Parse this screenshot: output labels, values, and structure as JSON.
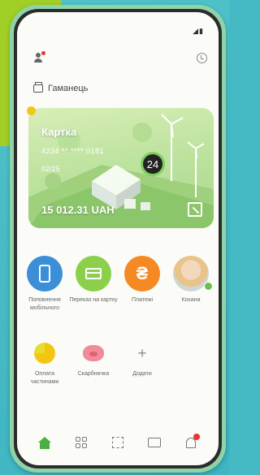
{
  "header": {
    "profile_icon": "profile-icon",
    "history_icon": "clock-icon"
  },
  "wallet": {
    "label": "Гаманець"
  },
  "card": {
    "title": "Картка",
    "number": "4234 ** **** 0181",
    "expiry": "02/25",
    "balance": "15 012.31 UAH",
    "day_badge": "24"
  },
  "actions": [
    {
      "label": "Поповнення мобільного",
      "icon": "phone-icon",
      "color": "#3b8fd6"
    },
    {
      "label": "Переказ на картку",
      "icon": "card-icon",
      "color": "#8ccf4a"
    },
    {
      "label": "Платежі",
      "icon": "hryvnia-icon",
      "color": "#f58a24"
    },
    {
      "label": "Коханa",
      "icon": "avatar",
      "color": ""
    },
    {
      "label": "Оплата частинами",
      "icon": "pie-icon",
      "color": "#f3c613"
    },
    {
      "label": "Скарбничка",
      "icon": "piggy-bank-icon",
      "color": "#f08b9a"
    },
    {
      "label": "Додати",
      "icon": "plus-icon",
      "color": "#888888"
    }
  ],
  "hryvnia_glyph": "₴",
  "plus_glyph": "+",
  "nav": [
    "home-icon",
    "grid-icon",
    "scan-icon",
    "inbox-icon",
    "bell-icon"
  ],
  "colors": {
    "accent": "#4caf3f",
    "screen_bg": "#fbfbf8"
  }
}
